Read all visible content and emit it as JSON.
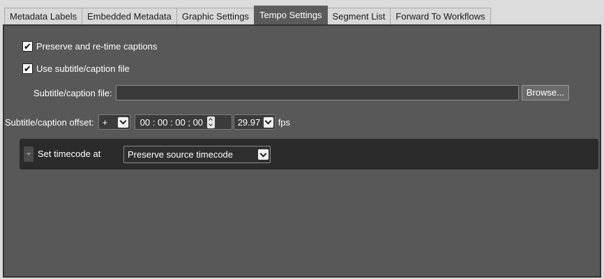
{
  "tabs": [
    {
      "label": "Metadata Labels"
    },
    {
      "label": "Embedded Metadata"
    },
    {
      "label": "Graphic Settings"
    },
    {
      "label": "Tempo Settings"
    },
    {
      "label": "Segment List"
    },
    {
      "label": "Forward To Workflows"
    }
  ],
  "active_tab": "Tempo Settings",
  "captions": {
    "preserve_label": "Preserve and re-time captions",
    "preserve_checked": true,
    "use_file_label": "Use subtitle/caption file",
    "use_file_checked": true,
    "check_glyph": "✔",
    "file_label": "Subtitle/caption file:",
    "file_value": "",
    "browse_label": "Browse..."
  },
  "offset": {
    "label": "Subtitle/caption offset:",
    "sign": "+",
    "timecode": "00 : 00 : 00 ; 00",
    "fps_value": "29.97",
    "fps_unit": "fps"
  },
  "timecode_section": {
    "label": "Set timecode at",
    "mode": "Preserve source timecode"
  },
  "colors": {
    "panel_bg": "#585858",
    "section_bg": "#2b2b2b",
    "tab_active_bg": "#5b5b5b",
    "tab_inactive_bg": "#d8d8d8"
  }
}
